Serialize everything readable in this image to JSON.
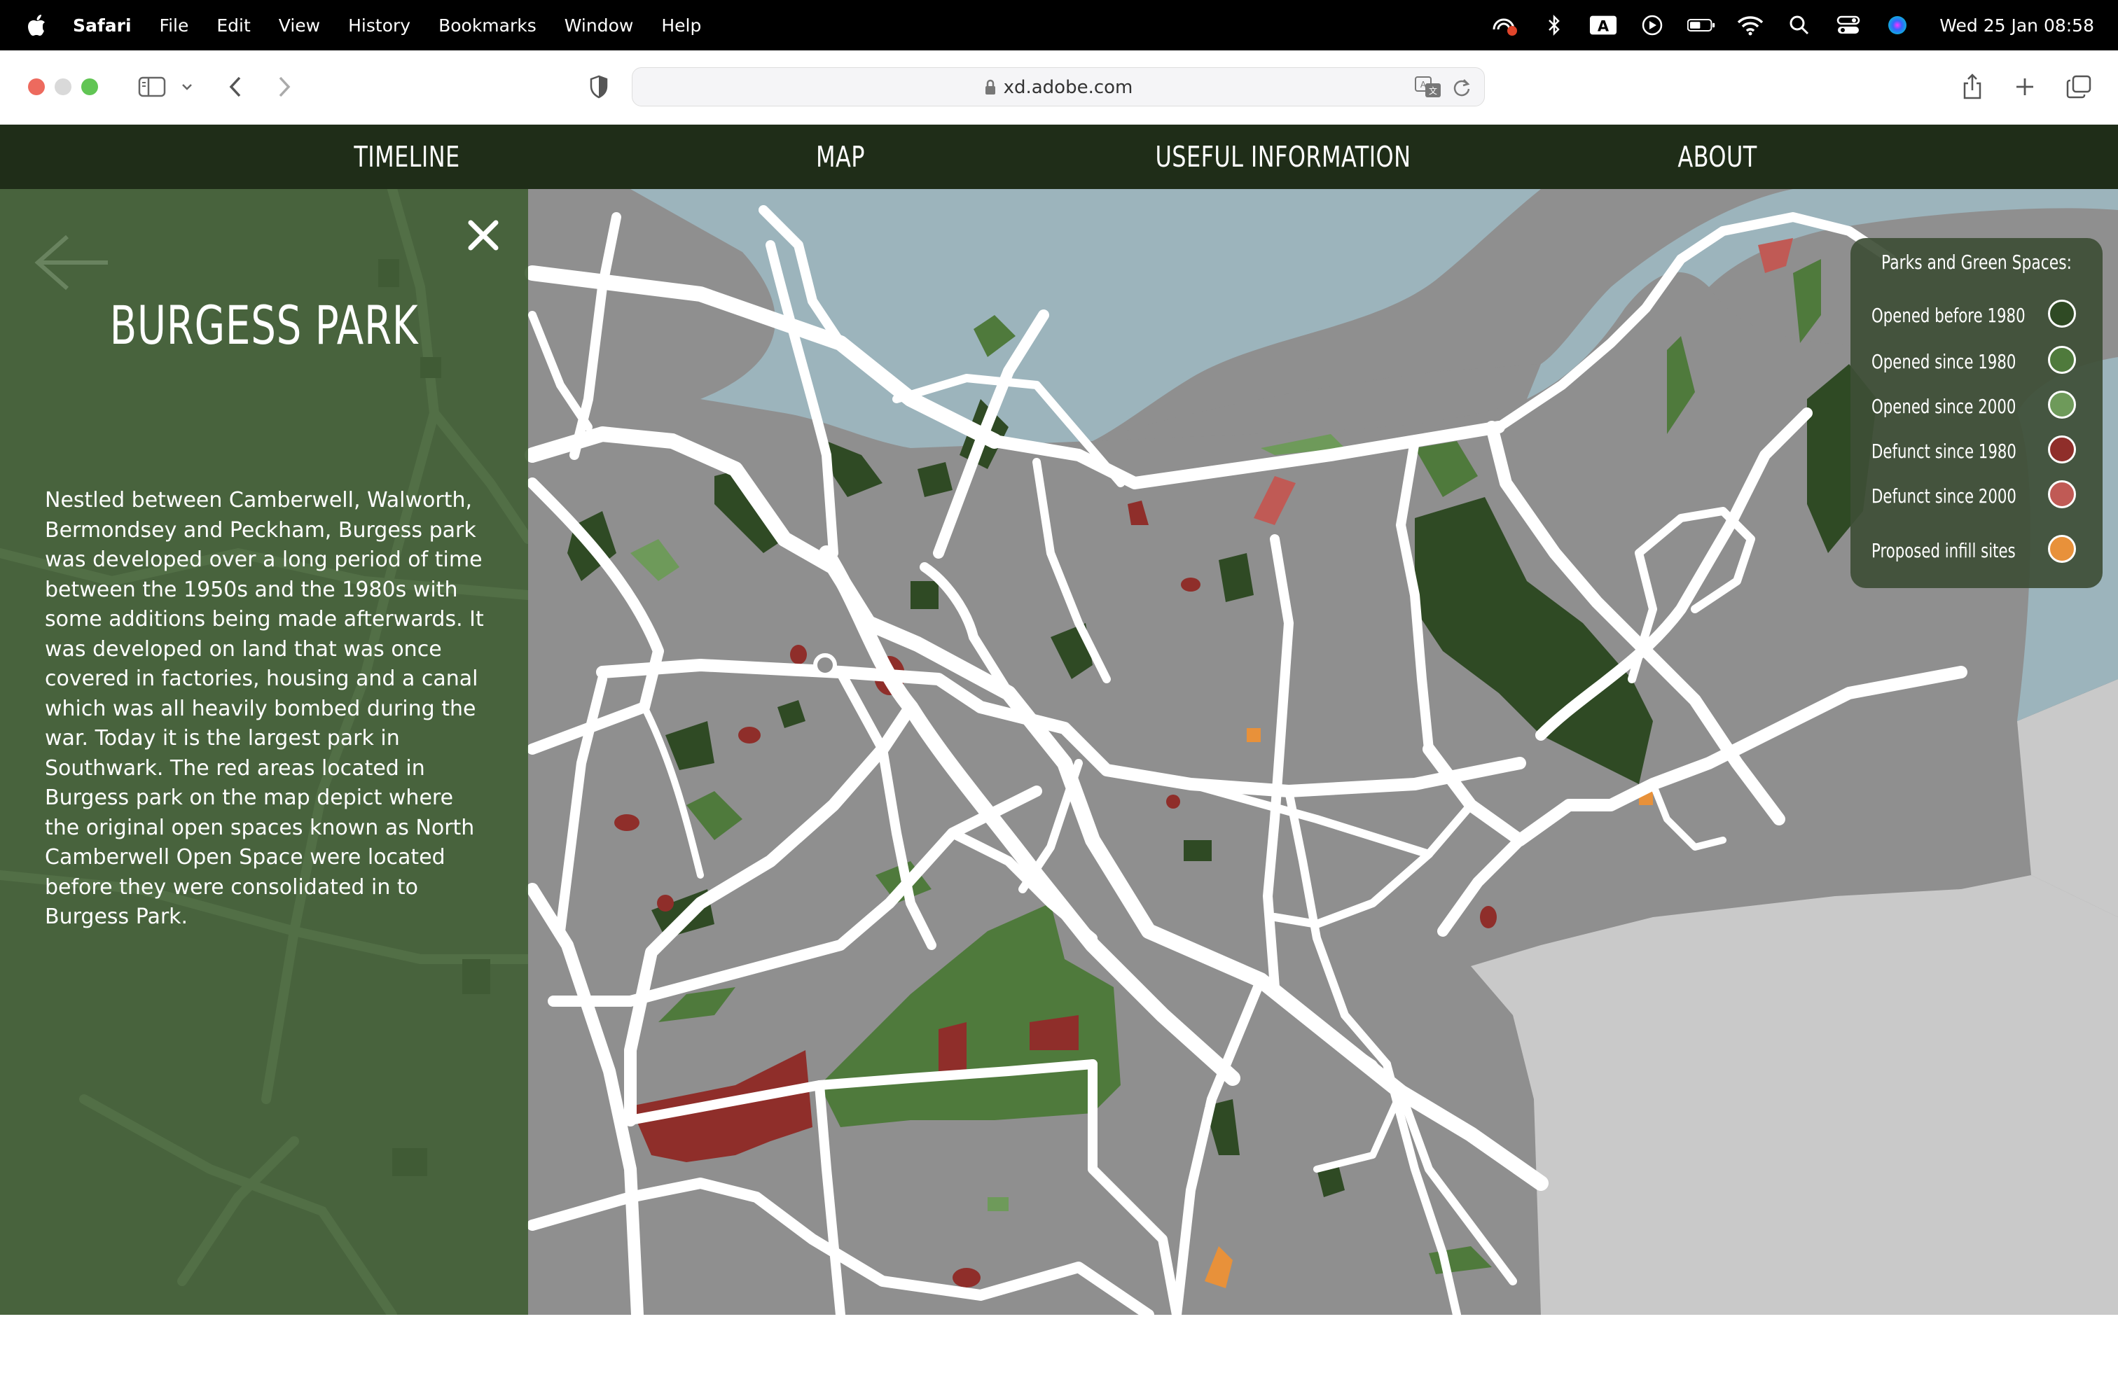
{
  "menubar": {
    "app_name": "Safari",
    "items": [
      "File",
      "Edit",
      "View",
      "History",
      "Bookmarks",
      "Window",
      "Help"
    ],
    "keyboard_input": "A",
    "clock": "Wed 25 Jan  08:58"
  },
  "toolbar": {
    "url": "xd.adobe.com"
  },
  "site_nav": {
    "links": [
      "TIMELINE",
      "MAP",
      "USEFUL INFORMATION",
      "ABOUT"
    ]
  },
  "panel": {
    "title": "BURGESS PARK",
    "description": "Nestled between Camberwell, Walworth, Bermondsey and Peckham, Burgess park was developed over a long period of time between the 1950s and the 1980s with some additions being made afterwards. It was developed on land that was once covered in factories, housing and a canal which was all heavily bombed during the war. Today it is the largest park in Southwark. The red areas located in Burgess park on the map depict where the original open spaces known as North Camberwell Open Space were located before they were consolidated in to Burgess Park."
  },
  "legend": {
    "title": "Parks and Green Spaces:",
    "items": [
      {
        "label": "Opened before 1980",
        "color": "#2f4a24"
      },
      {
        "label": "Opened since 1980",
        "color": "#4f7a3c"
      },
      {
        "label": "Opened since 2000",
        "color": "#6e9a5a"
      },
      {
        "label": "Defunct since 1980",
        "color": "#8f2e2a"
      },
      {
        "label": "Defunct since 2000",
        "color": "#c05a55"
      },
      {
        "label": "Proposed infill sites",
        "color": "#e8913a"
      }
    ]
  },
  "colors": {
    "nav_bg": "#1f2d18",
    "panel_bg": "#436037",
    "map_land": "#8f8f8f",
    "map_water": "#9cb4bc",
    "map_outside": "#c9c9c9",
    "roads": "#ffffff"
  }
}
